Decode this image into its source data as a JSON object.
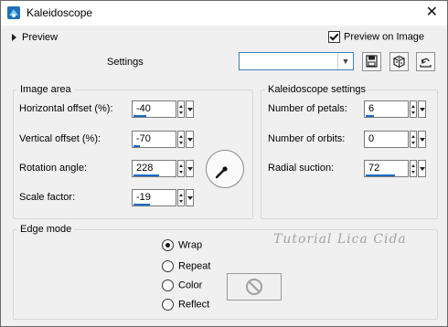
{
  "window": {
    "title": "Kaleidoscope",
    "close_glyph": "✕"
  },
  "top": {
    "preview_toggle_label": "Preview",
    "preview_on_image_label": "Preview on Image",
    "preview_on_image_checked": true,
    "settings_label": "Settings",
    "settings_value": ""
  },
  "image_area": {
    "legend": "Image area",
    "fields": [
      {
        "label": "Horizontal offset (%):",
        "value": "-40",
        "level": 0.3
      },
      {
        "label": "Vertical offset (%):",
        "value": "-70",
        "level": 0.15
      },
      {
        "label": "Rotation angle:",
        "value": "228",
        "level": 0.63
      },
      {
        "label": "Scale factor:",
        "value": "-19",
        "level": 0.4
      }
    ]
  },
  "kaleidoscope": {
    "legend": "Kaleidoscope settings",
    "fields": [
      {
        "label": "Number of petals:",
        "value": "6",
        "level": 0.2
      },
      {
        "label": "Number of orbits:",
        "value": "0",
        "level": 0.0
      },
      {
        "label": "Radial suction:",
        "value": "72",
        "level": 0.72
      }
    ]
  },
  "edge_mode": {
    "legend": "Edge mode",
    "options": [
      {
        "label": "Wrap",
        "selected": true
      },
      {
        "label": "Repeat",
        "selected": false
      },
      {
        "label": "Color",
        "selected": false
      },
      {
        "label": "Reflect",
        "selected": false
      }
    ]
  },
  "watermark": "Tutorial Lica Cida",
  "colors": {
    "accent": "#1b6ac9",
    "combo_border": "#3c7fb1"
  }
}
